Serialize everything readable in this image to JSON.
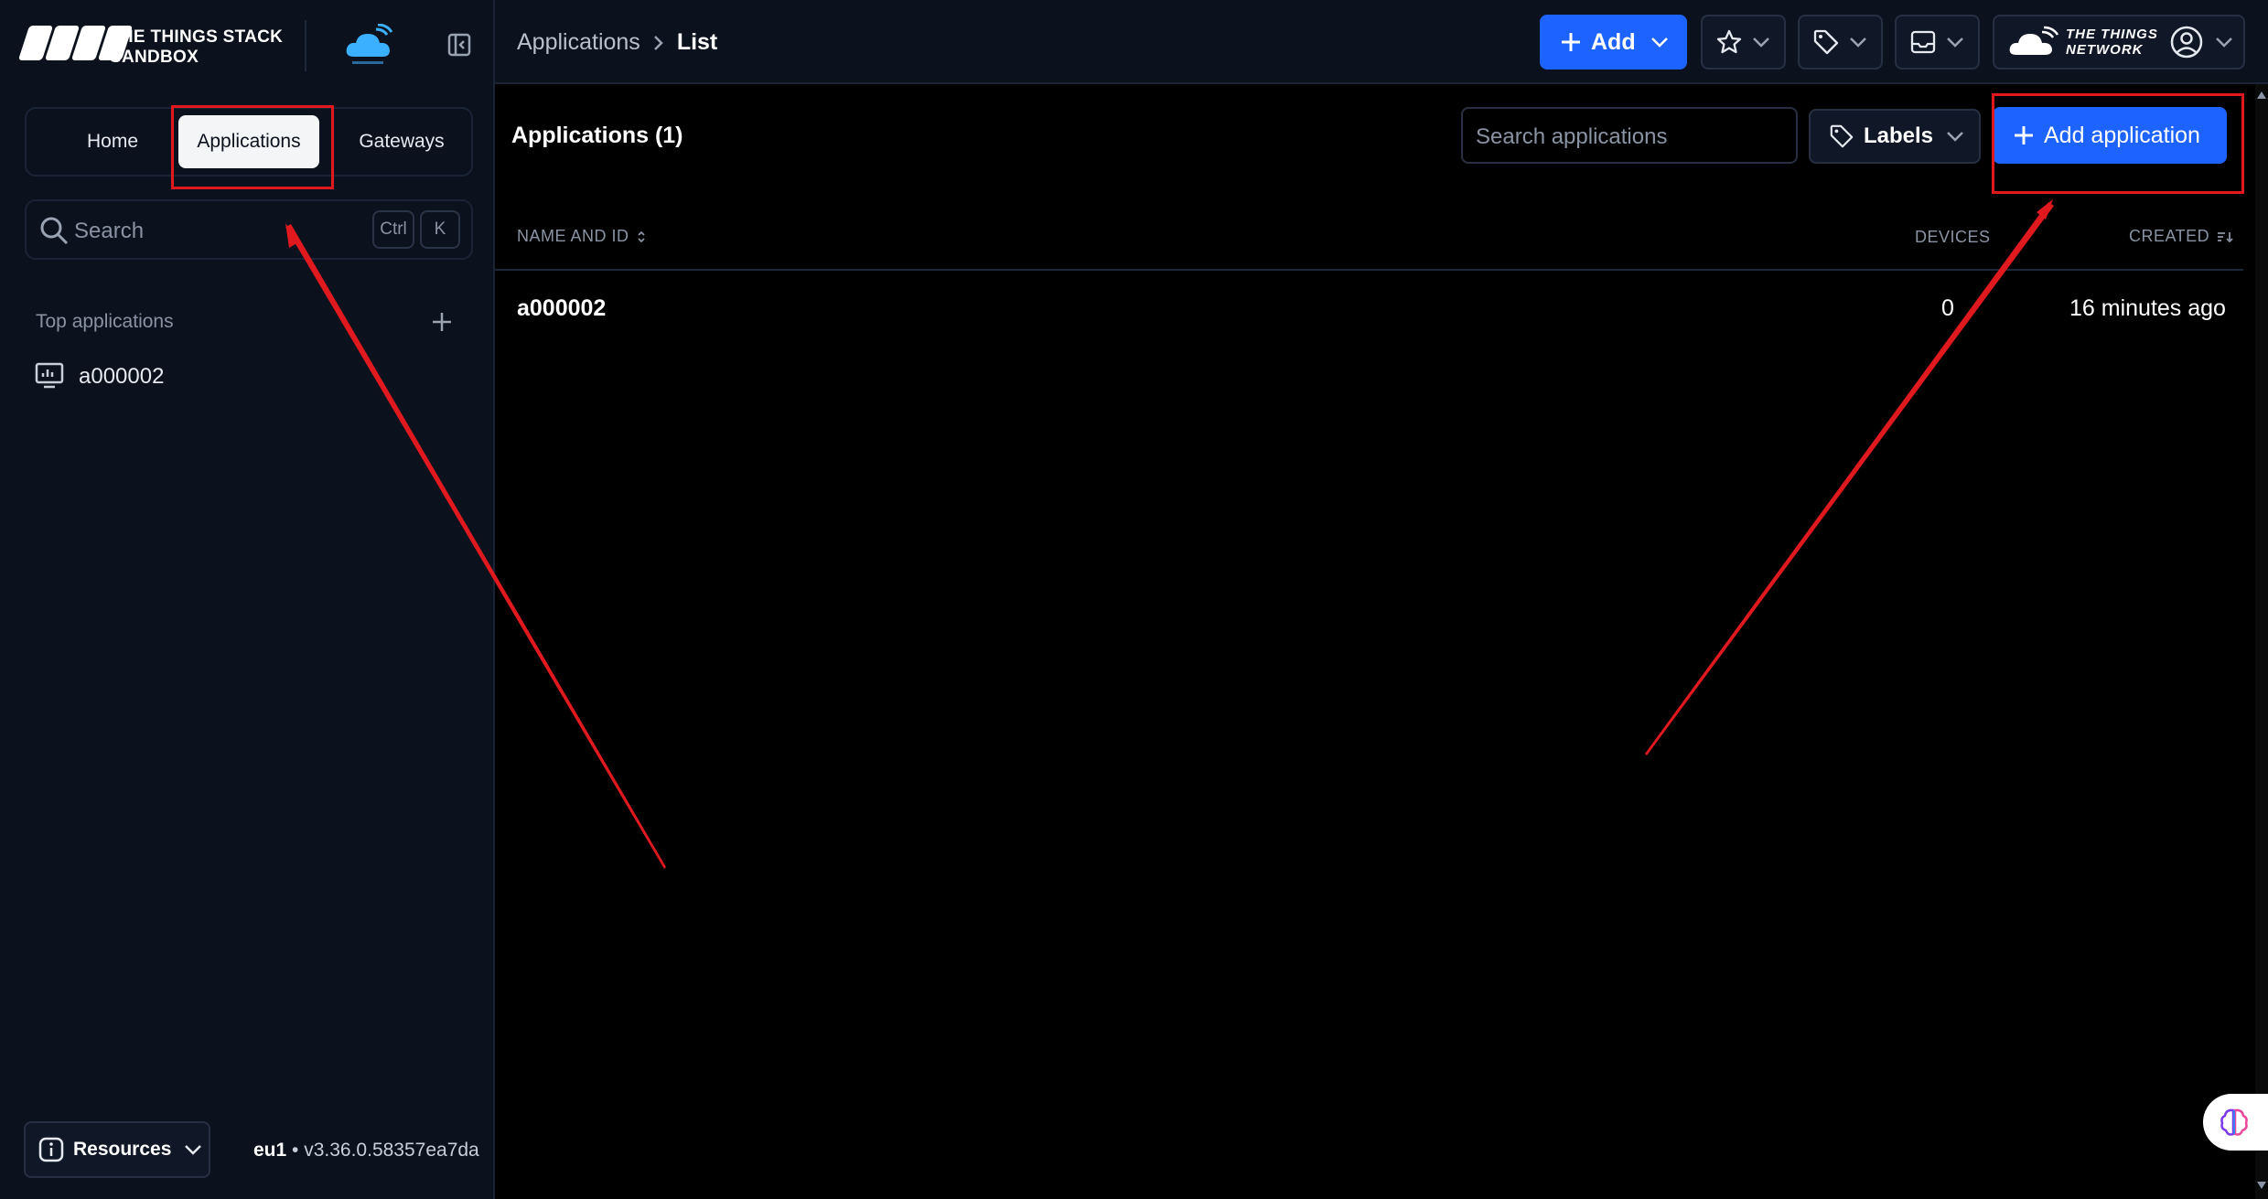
{
  "brand": {
    "line1": "THE THINGS STACK",
    "line2": "SANDBOX"
  },
  "breadcrumb": {
    "parent": "Applications",
    "current": "List"
  },
  "top_actions": {
    "add_label": "Add",
    "ttn_line1": "THE THINGS",
    "ttn_line2": "NETWORK"
  },
  "sidebar": {
    "tabs": [
      {
        "label": "Home"
      },
      {
        "label": "Applications"
      },
      {
        "label": "Gateways"
      }
    ],
    "search": {
      "placeholder": "Search",
      "kbd1": "Ctrl",
      "kbd2": "K"
    },
    "section_title": "Top applications",
    "items": [
      {
        "label": "a000002"
      }
    ],
    "resources_label": "Resources",
    "cluster": "eu1",
    "version": "• v3.36.0.58357ea7da"
  },
  "main": {
    "title": "Applications (1)",
    "search_placeholder": "Search applications",
    "labels_button": "Labels",
    "add_application_button": "Add application",
    "columns": {
      "name": "NAME AND ID",
      "devices": "DEVICES",
      "created": "CREATED"
    },
    "rows": [
      {
        "name": "a000002",
        "devices": "0",
        "created": "16 minutes ago"
      }
    ]
  },
  "colors": {
    "accent": "#1d63ff",
    "annotation": "#e0191f",
    "sidebar_bg": "#0b111d"
  }
}
